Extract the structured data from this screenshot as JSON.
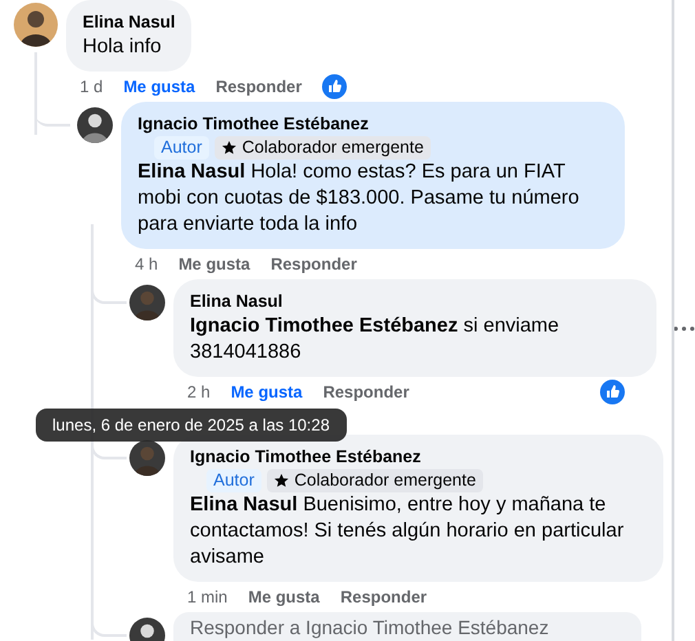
{
  "comments": [
    {
      "author": "Elina Nasul",
      "text": "Hola info",
      "highlighted": false,
      "time": "1 d",
      "like_label": "Me gusta",
      "liked": true,
      "reply_label": "Responder",
      "reaction": true,
      "menu_visible": false,
      "children": [
        {
          "author": "Ignacio Timothee Estébanez",
          "badges": [
            {
              "kind": "author",
              "label": "Autor"
            },
            {
              "kind": "contributor",
              "label": "Colaborador emergente"
            }
          ],
          "text": "**Elina Nasul** Hola! como estas? Es para un FIAT mobi con cuotas de $183.000. Pasame tu número para enviarte toda la info",
          "highlighted": true,
          "time": "4 h",
          "like_label": "Me gusta",
          "liked": false,
          "reply_label": "Responder",
          "reaction": false,
          "menu_visible": false,
          "children": [
            {
              "author": "Elina Nasul",
              "text": "**Ignacio Timothee Estébanez** si enviame 3814041886",
              "highlighted": false,
              "time": "2 h",
              "like_label": "Me gusta",
              "liked": true,
              "reply_label": "Responder",
              "reaction": true,
              "menu_visible": true
            },
            {
              "author": "Ignacio Timothee Estébanez",
              "badges": [
                {
                  "kind": "author",
                  "label": "Autor"
                },
                {
                  "kind": "contributor",
                  "label": "Colaborador emergente"
                }
              ],
              "text": "**Elina Nasul** Buenisimo, entre hoy y mañana te contactamos! Si tenés algún horario en particular avisame",
              "highlighted": false,
              "time": "1 min",
              "like_label": "Me gusta",
              "liked": false,
              "reply_label": "Responder",
              "reaction": false,
              "menu_visible": false
            }
          ],
          "reply_field": {
            "placeholder": "Responder a Ignacio Timothee Estébanez"
          }
        }
      ]
    }
  ],
  "tooltip": {
    "text": "lunes, 6 de enero de 2025 a las 10:28"
  }
}
